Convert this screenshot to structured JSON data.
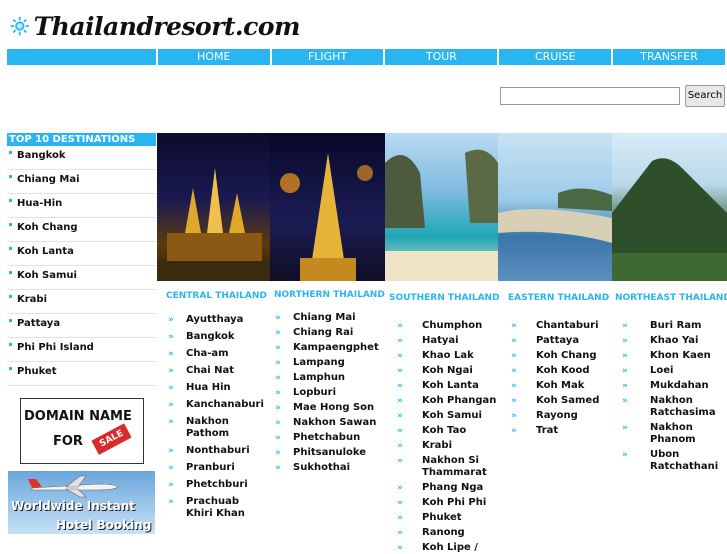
{
  "logo": {
    "text": "Thailandresort.com"
  },
  "nav": {
    "items": [
      "HOME",
      "FLIGHT",
      "TOUR",
      "CRUISE",
      "TRANSFER"
    ]
  },
  "search": {
    "button": "Search",
    "value": ""
  },
  "sidebar": {
    "title": "TOP 10 DESTINATIONS",
    "items": [
      "Bangkok",
      "Chiang Mai",
      "Hua-Hin",
      "Koh Chang",
      "Koh Lanta",
      "Koh Samui",
      "Krabi",
      "Pattaya",
      "Phi Phi Island",
      "Phuket"
    ]
  },
  "ads": {
    "domain": {
      "line1": "DOMAIN NAME",
      "line2": "FOR",
      "badge": "SALE"
    },
    "hotel": {
      "line1": "Worldwide Instant",
      "line2": "Hotel Booking"
    }
  },
  "regions": [
    {
      "title": "CENTRAL THAILAND",
      "items": [
        "Ayutthaya",
        "Bangkok",
        "Cha-am",
        "Chai Nat",
        "Hua Hin",
        "Kanchanaburi",
        "Nakhon Pathom",
        "Nonthaburi",
        "Pranburi",
        "Phetchburi",
        "Prachuab Khiri Khan"
      ]
    },
    {
      "title": "NORTHERN THAILAND",
      "items": [
        "Chiang Mai",
        "Chiang Rai",
        "Kampaengphet",
        "Lampang",
        "Lamphun",
        "Lopburi",
        "Mae Hong Son",
        "Nakhon Sawan",
        "Phetchabun",
        "Phitsanuloke",
        "Sukhothai"
      ]
    },
    {
      "title": "SOUTHERN THAILAND",
      "items": [
        "Chumphon",
        "Hatyai",
        "Khao Lak",
        "Koh Ngai",
        "Koh Lanta",
        "Koh Phangan",
        "Koh Samui",
        "Koh Tao",
        "Krabi",
        "Nakhon Si Thammarat",
        "Phang Nga",
        "Koh Phi Phi",
        "Phuket",
        "Ranong",
        "Koh Lipe /"
      ]
    },
    {
      "title": "EASTERN THAILAND",
      "items": [
        "Chantaburi",
        "Pattaya",
        "Koh Chang",
        "Koh Kood",
        "Koh Mak",
        "Koh Samed",
        "Rayong",
        "Trat"
      ]
    },
    {
      "title": "NORTHEAST THAILAND",
      "items": [
        "Buri Ram",
        "Khao Yai",
        "Khon Kaen",
        "Loei",
        "Mukdahan",
        "Nakhon Ratchasima",
        "Nakhon Phanom",
        "Ubon Ratchathani"
      ]
    }
  ]
}
